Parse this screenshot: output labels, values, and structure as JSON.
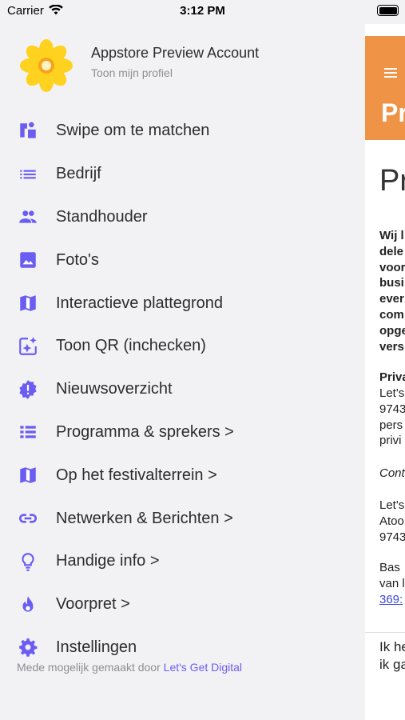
{
  "status_bar": {
    "carrier": "Carrier",
    "time": "3:12 PM"
  },
  "account": {
    "name": "Appstore Preview Account",
    "subtitle": "Toon mijn profiel"
  },
  "menu": [
    {
      "label": "Swipe om te matchen",
      "icon": "swipe-match-icon"
    },
    {
      "label": "Bedrijf",
      "icon": "list-icon"
    },
    {
      "label": "Standhouder",
      "icon": "people-icon"
    },
    {
      "label": "Foto's",
      "icon": "image-icon"
    },
    {
      "label": "Interactieve plattegrond",
      "icon": "map-icon"
    },
    {
      "label": "Toon QR (inchecken)",
      "icon": "qr-sparkle-icon"
    },
    {
      "label": "Nieuwsoverzicht",
      "icon": "alert-badge-icon"
    },
    {
      "label": "Programma & sprekers >",
      "icon": "schedule-list-icon"
    },
    {
      "label": "Op het festivalterrein >",
      "icon": "map-icon"
    },
    {
      "label": "Netwerken & Berichten >",
      "icon": "link-icon"
    },
    {
      "label": "Handige info >",
      "icon": "lightbulb-icon"
    },
    {
      "label": "Voorpret >",
      "icon": "flame-icon"
    },
    {
      "label": "Instellingen",
      "icon": "gear-icon"
    }
  ],
  "footer": {
    "prefix": "Mede mogelijk gemaakt door",
    "link": "Let's Get Digital"
  },
  "main": {
    "header_title": "Pr",
    "page_title": "Pr",
    "intro": "Wij l\ndele\nvoor\nbusi\never\ncom\nopge\nvers",
    "privacy_heading": "Priva",
    "privacy_text": "Let's\n9743\npers\nprivi",
    "contact": "Conta",
    "address": "Let's\nAtoo\n9743",
    "contact_name": "Bas\nvan l",
    "phone": "369:",
    "bottom": "Ik he\nik ga"
  },
  "colors": {
    "accent": "#6b5df2",
    "header": "#ef9346"
  }
}
